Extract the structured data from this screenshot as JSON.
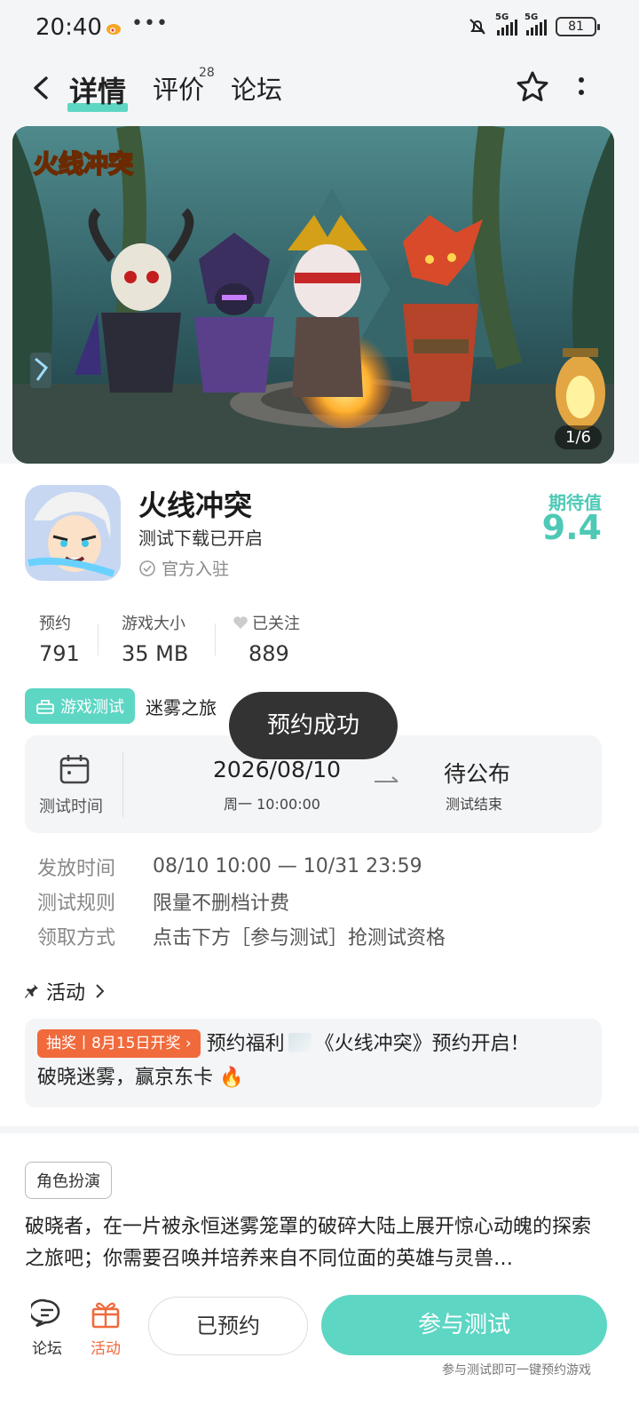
{
  "status_bar": {
    "time": "20:40",
    "battery": "81"
  },
  "nav": {
    "tabs": [
      {
        "label": "详情"
      },
      {
        "label": "评价",
        "count": "28"
      },
      {
        "label": "论坛"
      }
    ]
  },
  "banner": {
    "logo_text": "火线冲突",
    "counter": "1/6"
  },
  "game": {
    "name": "火线冲突",
    "status": "测试下载已开启",
    "official": "官方入驻",
    "expect_label": "期待值",
    "expect_value": "9.4"
  },
  "stats": [
    {
      "label": "预约",
      "value": "791"
    },
    {
      "label": "游戏大小",
      "value": "35 MB"
    },
    {
      "label": "已关注",
      "value": "889"
    }
  ],
  "test": {
    "badge": "游戏测试",
    "name": "迷雾之旅",
    "label": "测试时间",
    "start_date": "2026/08/10",
    "start_sub": "周一  10:00:00",
    "end": "待公布",
    "end_sub": "测试结束"
  },
  "toast": "预约成功",
  "info": [
    {
      "key": "发放时间",
      "value": "08/10 10:00 — 10/31 23:59"
    },
    {
      "key": "测试规则",
      "value": "限量不删档计费"
    },
    {
      "key": "领取方式",
      "value": "点击下方［参与测试］抢测试资格"
    }
  ],
  "activity": {
    "title": "活动",
    "lottery": "抽奖丨8月15日开奖 ›",
    "text1": "预约福利",
    "text2": "《火线冲突》预约开启！",
    "text3": "破晓迷雾，赢京东卡 🔥"
  },
  "genre": "角色扮演",
  "description": "破晓者，在一片被永恒迷雾笼罩的破碎大陆上展开惊心动魄的探索之旅吧；你需要召唤并培养来自不同位面的英雄与灵兽…",
  "bottom": {
    "forum": "论坛",
    "activity": "活动",
    "reserved": "已预约",
    "join": "参与测试",
    "hint": "参与测试即可一键预约游戏"
  },
  "colors": {
    "accent": "#5ed6c4",
    "orange": "#f06a3c",
    "dark_toast": "#333333"
  }
}
